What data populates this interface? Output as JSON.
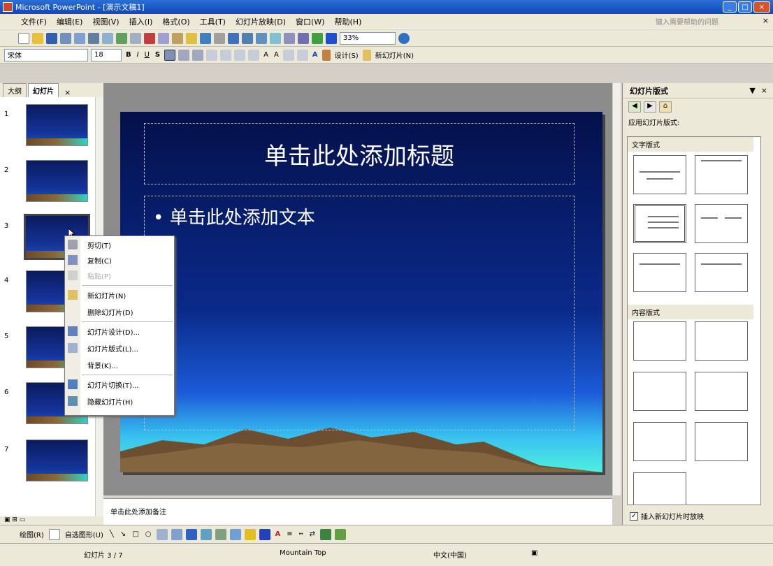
{
  "app": {
    "title": "Microsoft PowerPoint - [演示文稿1]"
  },
  "menu": {
    "items": [
      "文件(F)",
      "编辑(E)",
      "视图(V)",
      "插入(I)",
      "格式(O)",
      "工具(T)",
      "幻灯片放映(D)",
      "窗口(W)",
      "帮助(H)"
    ],
    "help_placeholder": "键入需要帮助的问题",
    "help_close": "×"
  },
  "toolbar": {
    "zoom": "33%",
    "font": "宋体",
    "size": "18",
    "design_label": "设计(S)",
    "new_slide_label": "新幻灯片(N)"
  },
  "tabs": {
    "outline": "大纲",
    "slides": "幻灯片",
    "close": "×"
  },
  "thumbs": [
    "1",
    "2",
    "3",
    "4",
    "5",
    "6",
    "7"
  ],
  "slide": {
    "title_placeholder": "单击此处添加标题",
    "body_placeholder": "• 单击此处添加文本"
  },
  "notes": {
    "placeholder": "单击此处添加备注"
  },
  "context_menu": {
    "items": [
      {
        "label": "剪切(T)",
        "disabled": false
      },
      {
        "label": "复制(C)",
        "disabled": false
      },
      {
        "label": "粘贴(P)",
        "disabled": true
      },
      {
        "label": "新幻灯片(N)",
        "disabled": false
      },
      {
        "label": "删除幻灯片(D)",
        "disabled": false
      },
      {
        "label": "幻灯片设计(D)...",
        "disabled": false
      },
      {
        "label": "幻灯片版式(L)...",
        "disabled": false
      },
      {
        "label": "背景(K)...",
        "disabled": false
      },
      {
        "label": "幻灯片切换(T)...",
        "disabled": false
      },
      {
        "label": "隐藏幻灯片(H)",
        "disabled": false
      }
    ]
  },
  "taskpane": {
    "title": "幻灯片版式",
    "apply_label": "应用幻灯片版式:",
    "text_layouts": "文字版式",
    "content_layouts": "内容版式",
    "show_on_insert": "插入新幻灯片时放映",
    "close": "×",
    "dropdown": "▼"
  },
  "bottom_toolbar": {
    "draw": "绘图(R)",
    "autoshapes": "自选图形(U)"
  },
  "statusbar": {
    "slide_pos": "幻灯片 3 / 7",
    "design": "Mountain Top",
    "lang": "中文(中国)"
  },
  "colors": {
    "accent": "#1047b8",
    "slide_top": "#04104a",
    "slide_bottom": "#4df0e0"
  }
}
